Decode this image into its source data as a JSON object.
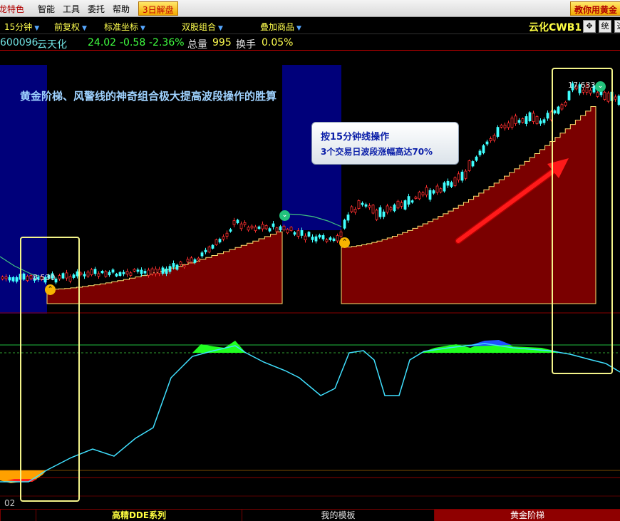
{
  "menubar": {
    "items": [
      "龙特色",
      "智能",
      "工具",
      "委托",
      "帮助"
    ],
    "promo": "3日解盘",
    "promo_right": "教你用黄金"
  },
  "toolbar": {
    "period": "15分钟",
    "adjust": "前复权",
    "coords": "标准坐标",
    "combo": "双股组合",
    "overlay": "叠加商品",
    "stock_title": "云化CWB1",
    "btn_move_icon": "move-icon",
    "btn_stat": "统",
    "btn_next": "选"
  },
  "quote": {
    "code": "600096",
    "name": "云天化",
    "price": "24.02",
    "change": "-0.58",
    "change_pct": "-2.36%",
    "volume_label": "总量",
    "volume": "995",
    "turnover_label": "换手",
    "turnover": "0.05%"
  },
  "annotations": {
    "headline": "黄金阶梯、风警线的神奇组合极大提高波段操作的胜算",
    "callout_line1": "按15分钟线操作",
    "callout_line2": "3个交易日波段涨幅高达70%",
    "low_price": "8.530",
    "high_price": "17.633",
    "x_axis_label": "02"
  },
  "bottom_tabs": [
    "",
    "高精DDE系列",
    "我的模板",
    "黄金阶梯"
  ],
  "colors": {
    "up": "#ff3030",
    "down": "#40ffff",
    "ladder_fill": "#7a0000",
    "ladder_line": "#ffe070",
    "blue_zone": "#00007a",
    "warning_line": "#40c080",
    "dde_line": "#40e0ff",
    "highlight_box": "#f4f48a",
    "signal_arrow": "#ff1a1a"
  }
}
